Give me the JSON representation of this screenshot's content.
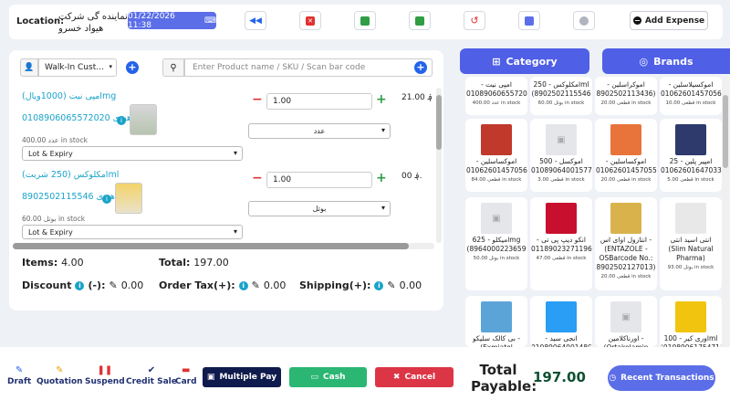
{
  "header": {
    "location_label": "Location:",
    "company_line1": "نماینده گی شرکت",
    "company_line2": "هیواد خسرو",
    "datetime": "01/22/2026 11:38",
    "add_expense": "Add Expense"
  },
  "cart": {
    "customer": "Walk-In Cust...",
    "search_placeholder": "Enter Product name / SKU / Scan bar code",
    "items": [
      {
        "name": "امپی نیت (1000ویال)mg",
        "code": "0108906065572020",
        "origin": "هندی",
        "stock": "400.00 عدد in stock",
        "lot": "Lot & Expiry",
        "qty": "1.00",
        "unit": "عدد",
        "price": "؋ 21.00"
      },
      {
        "name": "امکلوکس (250 شربت)ml",
        "code": "8902502115546",
        "origin": "هندی",
        "stock": "60.00 بوتل in stock",
        "lot": "Lot & Expiry",
        "qty": "1.00",
        "unit": "بوتل",
        "price": "؋ 00."
      }
    ],
    "items_label": "Items:",
    "items_value": "4.00",
    "total_label": "Total:",
    "total_value": "197.00",
    "discount_label": "Discount",
    "discount_sign": "(-):",
    "discount_value": "0.00",
    "ordertax_label": "Order Tax(+):",
    "ordertax_value": "0.00",
    "shipping_label": "Shipping(+):",
    "shipping_value": "0.00"
  },
  "tabs": {
    "category": "Category",
    "brands": "Brands"
  },
  "products": [
    {
      "name": "امپی نیت - (0108906065572020",
      "stock": "400.00 عدد in stock",
      "color": "#ffffff"
    },
    {
      "name": "امکلوکس - 250ml (8902502115546",
      "stock": "60.00 بوتل in stock",
      "color": "#ffffff"
    },
    {
      "name": "اموکراسلین - (8902502113436",
      "stock": "20.00 قطعی in stock",
      "color": "#ffffff"
    },
    {
      "name": "اموکسیلاسلین - (0106260145705657",
      "stock": "10.00 قطعی in stock",
      "color": "#ffffff"
    },
    {
      "name": "اموکساسلین - (0106260145705640",
      "stock": "84.00 قطعی in stock",
      "color": "#c0392b"
    },
    {
      "name": "اموکسل - 500 (0108906400157724",
      "stock": "3.00 قطعی in stock",
      "color": "#e4e6ea"
    },
    {
      "name": "اموکساسلین - (0106260145705548",
      "stock": "20.00 قطعی in stock",
      "color": "#e8743b"
    },
    {
      "name": "امپیر پلین - 25 (0106260164703313",
      "stock": "5.00 قطعی in stock",
      "color": "#2d3a6b"
    },
    {
      "name": "امیکلو - 625mg (8964000223659",
      "stock": "50.00 بوتل in stock",
      "color": "#e4e6ea"
    },
    {
      "name": "انکو دیپ پی تی - (0118902327119665",
      "stock": "47.00 قطعی in stock",
      "color": "#c8102e"
    },
    {
      "name": "انتازول اوای اس - (ENTAZOLE - OSBarcode No.: 8902502127013)",
      "stock": "20.00 قطعی in stock",
      "color": "#d9b24c"
    },
    {
      "name": "انتی اسید انتی (Slim Natural Pharma)",
      "stock": "93.00 بوتل in stock",
      "color": "#e8e8e8"
    },
    {
      "name": "بی کالک سلیکو - (Exmiatol",
      "stock": "",
      "color": "#5ba4d8"
    },
    {
      "name": "انجی سید - (0108906400148067",
      "stock": "",
      "color": "#2a9df4"
    },
    {
      "name": "اورناکلامین - (Ortakolamin",
      "stock": "",
      "color": "#e4e6ea"
    },
    {
      "name": "اوری کیر - 100ml (0108906175471230",
      "stock": "",
      "color": "#f1c40f"
    }
  ],
  "actions": {
    "draft": "Draft",
    "quotation": "Quotation",
    "suspend": "Suspend",
    "credit_sale": "Credit Sale",
    "card": "Card",
    "multiple_pay": "Multiple Pay",
    "cash": "Cash",
    "cancel": "Cancel",
    "total_payable": "Total Payable:",
    "total_payable_value": "197.00",
    "recent": "Recent Transactions"
  },
  "colors": {
    "accent": "#5b6ee8",
    "cash": "#2bb673",
    "cancel": "#dc3545",
    "multipay": "#0f1b4c",
    "link": "#1aa3c9"
  }
}
